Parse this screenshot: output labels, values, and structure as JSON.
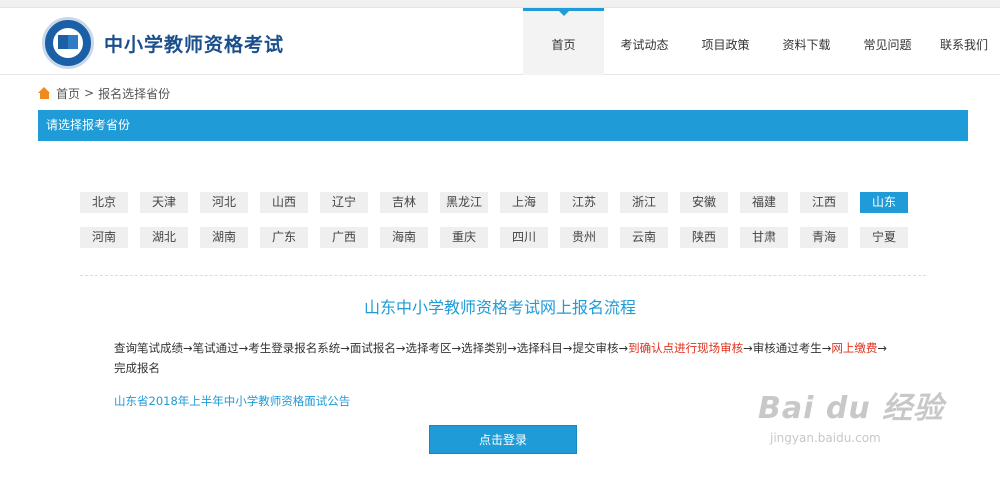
{
  "header": {
    "site_title": "中小学教师资格考试",
    "nav": [
      {
        "label": "首页",
        "active": true
      },
      {
        "label": "考试动态",
        "active": false
      },
      {
        "label": "项目政策",
        "active": false
      },
      {
        "label": "资料下载",
        "active": false
      },
      {
        "label": "常见问题",
        "active": false
      },
      {
        "label": "联系我们",
        "active": false
      }
    ]
  },
  "breadcrumb": {
    "home": "首页",
    "sep": ">",
    "current": "报名选择省份"
  },
  "province_bar": {
    "title": "请选择报考省份"
  },
  "provinces": {
    "row1": [
      "北京",
      "天津",
      "河北",
      "山西",
      "辽宁",
      "吉林",
      "黑龙江",
      "上海",
      "江苏",
      "浙江",
      "安徽",
      "福建",
      "江西",
      "山东"
    ],
    "row2": [
      "河南",
      "湖北",
      "湖南",
      "广东",
      "广西",
      "海南",
      "重庆",
      "四川",
      "贵州",
      "云南",
      "陕西",
      "甘肃",
      "青海",
      "宁夏"
    ],
    "selected": "山东"
  },
  "flow": {
    "title": "山东中小学教师资格考试网上报名流程",
    "part1": "查询笔试成绩→笔试通过→考生登录报名系统→面试报名→选择考区→选择类别→选择科目→提交审核→",
    "part2_red": "到确认点进行现场审核",
    "part3": "→审核通过考生→",
    "part4_red": "网上缴费",
    "part5": "→完成报名"
  },
  "notice": {
    "text": "山东省2018年上半年中小学教师资格面试公告"
  },
  "login": {
    "label": "点击登录"
  },
  "watermark": {
    "big": "Bai du 经验",
    "small": "jingyan.baidu.com"
  },
  "colors": {
    "accent": "#1f9bd7",
    "highlight_red": "#e0311c",
    "home_icon": "#f08a1c"
  }
}
